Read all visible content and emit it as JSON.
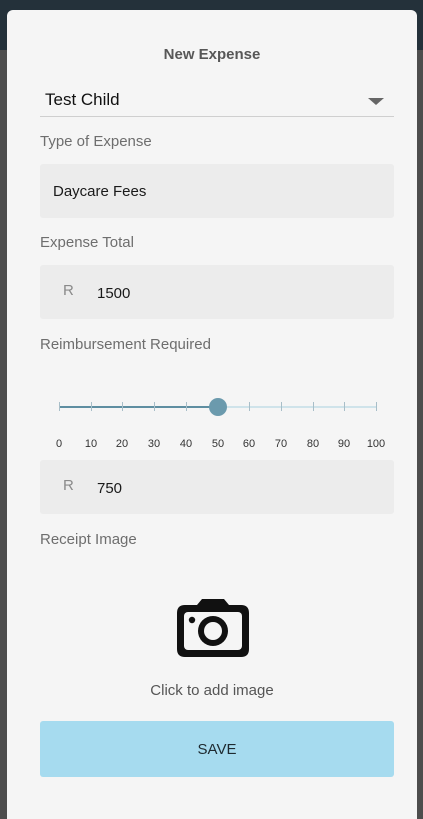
{
  "dialog": {
    "title": "New Expense"
  },
  "child_select": {
    "selected": "Test Child"
  },
  "expense_type": {
    "label": "Type of Expense",
    "value": "Daycare Fees"
  },
  "expense_total": {
    "label": "Expense Total",
    "currency": "R",
    "value": "1500"
  },
  "reimbursement": {
    "label": "Reimbursement Required",
    "percent": 50,
    "min": 0,
    "max": 100,
    "ticks": [
      "0",
      "10",
      "20",
      "30",
      "40",
      "50",
      "60",
      "70",
      "80",
      "90",
      "100"
    ],
    "currency": "R",
    "amount": "750"
  },
  "receipt": {
    "label": "Receipt Image",
    "icon": "camera-icon",
    "hint": "Click to add image"
  },
  "save_button": {
    "label": "SAVE",
    "color": "#a6dbef"
  }
}
